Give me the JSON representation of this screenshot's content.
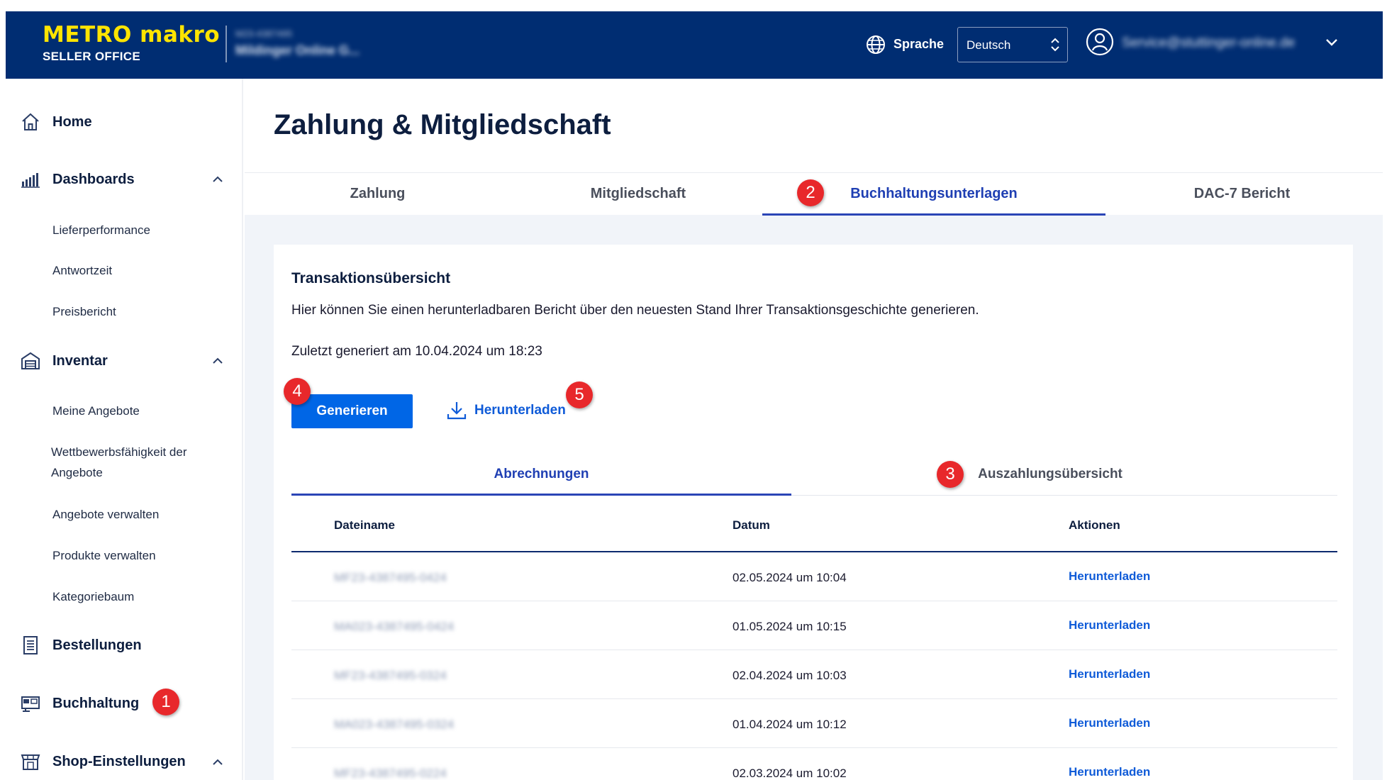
{
  "header": {
    "brand_name": "METRO makro",
    "brand_sub": "SELLER OFFICE",
    "account_id": "M23-4387495",
    "account_name": "Mildinger Online G...",
    "language_label": "Sprache",
    "language_value": "Deutsch",
    "user_email": "Service@stuttinger-online.de"
  },
  "sidebar": {
    "home": "Home",
    "dashboards": "Dashboards",
    "dashboard_items": [
      "Lieferperformance",
      "Antwortzeit",
      "Preisbericht"
    ],
    "inventar": "Inventar",
    "inventar_items": [
      "Meine Angebote",
      "Wettbewerbsfähigkeit der",
      "Angebote",
      "Angebote verwalten",
      "Produkte verwalten",
      "Kategoriebaum"
    ],
    "bestellungen": "Bestellungen",
    "buchhaltung": "Buchhaltung",
    "shop": "Shop-Einstellungen"
  },
  "annotations": [
    "1",
    "2",
    "3",
    "4",
    "5"
  ],
  "page": {
    "title": "Zahlung & Mitgliedschaft",
    "tabs": [
      "Zahlung",
      "Mitgliedschaft",
      "Buchhaltungsunterlagen",
      "DAC-7 Bericht"
    ]
  },
  "card": {
    "title": "Transaktionsübersicht",
    "description": "Hier können Sie einen herunterladbaren Bericht über den neuesten Stand Ihrer Transaktionsgeschichte generieren.",
    "last_generated": "Zuletzt generiert am 10.04.2024 um 18:23",
    "generate_button": "Generieren",
    "download_button": "Herunterladen",
    "subtabs": [
      "Abrechnungen",
      "Auszahlungsübersicht"
    ]
  },
  "table": {
    "columns": [
      "Dateiname",
      "Datum",
      "Aktionen"
    ],
    "rows": [
      {
        "file": "MF23-4387495-0424",
        "date": "02.05.2024 um 10:04",
        "action": "Herunterladen"
      },
      {
        "file": "MA023-4387495-0424",
        "date": "01.05.2024 um 10:15",
        "action": "Herunterladen"
      },
      {
        "file": "MF23-4387495-0324",
        "date": "02.04.2024 um 10:03",
        "action": "Herunterladen"
      },
      {
        "file": "MA023-4387495-0324",
        "date": "01.04.2024 um 10:12",
        "action": "Herunterladen"
      },
      {
        "file": "MF23-4387495-0224",
        "date": "02.03.2024 um 10:02",
        "action": "Herunterladen"
      }
    ]
  },
  "colors": {
    "header_bg": "#002d72",
    "brand_yellow": "#ffe400",
    "primary_button": "#0066e6",
    "link_blue": "#0f5bd8",
    "active_tab": "#2b45b6",
    "badge_red": "#e8282b"
  }
}
